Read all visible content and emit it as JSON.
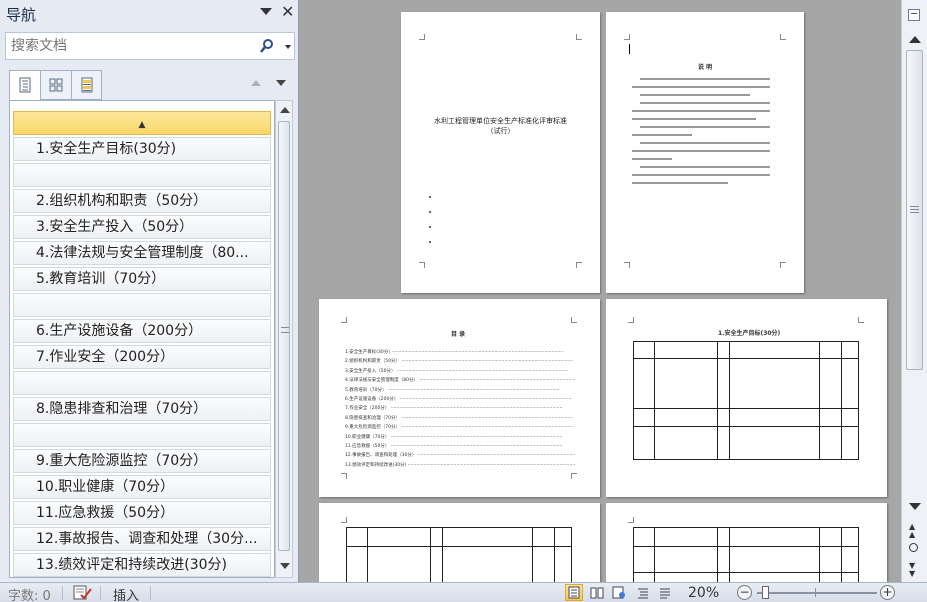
{
  "nav": {
    "title": "导航",
    "search_placeholder": "搜索文档",
    "headings": [
      {
        "label": "",
        "kind": "collapse"
      },
      {
        "label": "1.安全生产目标(30分)",
        "kind": "item"
      },
      {
        "label": "",
        "kind": "blank"
      },
      {
        "label": "2.组织机构和职责（50分）",
        "kind": "item"
      },
      {
        "label": "3.安全生产投入（50分）",
        "kind": "item"
      },
      {
        "label": "4.法律法规与安全管理制度（80...",
        "kind": "item"
      },
      {
        "label": "5.教育培训（70分）",
        "kind": "item"
      },
      {
        "label": "",
        "kind": "blank"
      },
      {
        "label": "6.生产设施设备（200分）",
        "kind": "item"
      },
      {
        "label": "7.作业安全（200分）",
        "kind": "item"
      },
      {
        "label": "",
        "kind": "blank"
      },
      {
        "label": "8.隐患排查和治理（70分）",
        "kind": "item"
      },
      {
        "label": "",
        "kind": "blank"
      },
      {
        "label": "9.重大危险源监控（70分）",
        "kind": "item"
      },
      {
        "label": "10.职业健康（70分）",
        "kind": "item"
      },
      {
        "label": "11.应急救援（50分）",
        "kind": "item"
      },
      {
        "label": "12.事故报告、调查和处理（30分...",
        "kind": "item"
      },
      {
        "label": "13.绩效评定和持续改进(30分)",
        "kind": "item"
      }
    ]
  },
  "pages": {
    "cover_title": "水利工程管理单位安全生产标准化评审标准",
    "cover_subtitle": "（试行）",
    "notes_title": "说 明",
    "toc_title": "目 录",
    "toc_items": [
      "1.安全生产目标(30分)",
      "2.组织机构和职责（50分）",
      "3.安全生产投入（50分）",
      "4.法律法规与安全管理制度（80分）",
      "5.教育培训（70分）",
      "6.生产设施设备（200分）",
      "7.作业安全（200分）",
      "8.隐患排查和治理（70分）",
      "9.重大危险源监控（70分）",
      "10.职业健康（70分）",
      "11.应急救援（50分）",
      "12.事故报告、调查和处理（30分）",
      "13.绩效评定和持续改进(30分)"
    ],
    "page4_title": "1.安全生产目标(30分)"
  },
  "status": {
    "word_count": "字数: 0",
    "insert_mode": "插入",
    "zoom": "20%"
  },
  "colors": {
    "accent_selected": "#f8d768",
    "doc_background": "#a6a6a6",
    "pane_background": "#e6ebf3"
  }
}
